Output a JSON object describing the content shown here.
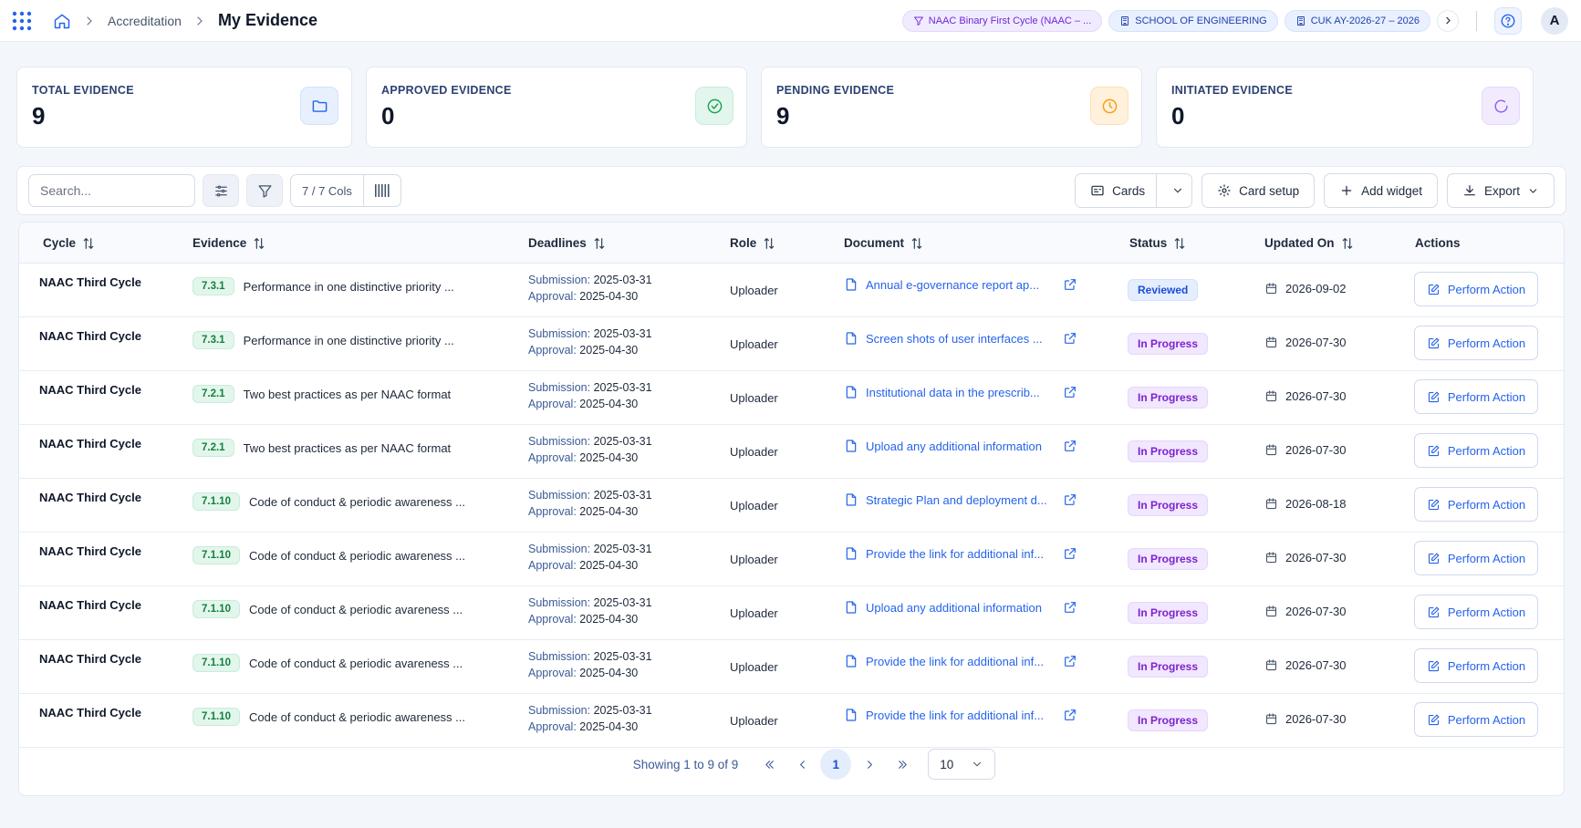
{
  "breadcrumb": {
    "parent": "Accreditation",
    "current": "My Evidence"
  },
  "context_chips": {
    "framework": "NAAC Binary First Cycle (NAAC – ...",
    "school": "SCHOOL OF ENGINEERING",
    "year": "CUK AY-2026-27 – 2026"
  },
  "user": {
    "avatar_initial": "A"
  },
  "stats": [
    {
      "label": "TOTAL EVIDENCE",
      "value": "9",
      "icon": "folder-icon",
      "accent": "#2563eb"
    },
    {
      "label": "APPROVED EVIDENCE",
      "value": "0",
      "icon": "check-circle-icon",
      "accent": "#16a34a"
    },
    {
      "label": "PENDING EVIDENCE",
      "value": "9",
      "icon": "clock-icon",
      "accent": "#f59e0b"
    },
    {
      "label": "INITIATED EVIDENCE",
      "value": "0",
      "icon": "spinner-icon",
      "accent": "#8b5cf6"
    }
  ],
  "toolbar": {
    "search_placeholder": "Search...",
    "cols_label": "7 / 7 Cols",
    "view_label": "Cards",
    "card_setup_label": "Card setup",
    "add_widget_label": "Add widget",
    "export_label": "Export"
  },
  "table": {
    "columns": [
      "Cycle",
      "Evidence",
      "Deadlines",
      "Role",
      "Document",
      "Status",
      "Updated On",
      "Actions"
    ],
    "deadline_labels": {
      "submission": "Submission:",
      "approval": "Approval:"
    },
    "rows": [
      {
        "cycle": "NAAC Third Cycle",
        "code": "7.3.1",
        "evidence": "Performance in one distinctive priority ...",
        "submission": "2025-03-31",
        "approval": "2025-04-30",
        "role": "Uploader",
        "document": "Annual e-governance report ap...",
        "status": "Reviewed",
        "updated": "2026-09-02",
        "action": "Perform Action"
      },
      {
        "cycle": "NAAC Third Cycle",
        "code": "7.3.1",
        "evidence": "Performance in one distinctive priority ...",
        "submission": "2025-03-31",
        "approval": "2025-04-30",
        "role": "Uploader",
        "document": "Screen shots of user interfaces ...",
        "status": "In Progress",
        "updated": "2026-07-30",
        "action": "Perform Action"
      },
      {
        "cycle": "NAAC Third Cycle",
        "code": "7.2.1",
        "evidence": "Two best practices as per NAAC format",
        "submission": "2025-03-31",
        "approval": "2025-04-30",
        "role": "Uploader",
        "document": "Institutional data in the prescrib...",
        "status": "In Progress",
        "updated": "2026-07-30",
        "action": "Perform Action"
      },
      {
        "cycle": "NAAC Third Cycle",
        "code": "7.2.1",
        "evidence": "Two best practices as per NAAC format",
        "submission": "2025-03-31",
        "approval": "2025-04-30",
        "role": "Uploader",
        "document": "Upload any additional information",
        "status": "In Progress",
        "updated": "2026-07-30",
        "action": "Perform Action"
      },
      {
        "cycle": "NAAC Third Cycle",
        "code": "7.1.10",
        "evidence": "Code of conduct & periodic awareness ...",
        "submission": "2025-03-31",
        "approval": "2025-04-30",
        "role": "Uploader",
        "document": "Strategic Plan and deployment d...",
        "status": "In Progress",
        "updated": "2026-08-18",
        "action": "Perform Action"
      },
      {
        "cycle": "NAAC Third Cycle",
        "code": "7.1.10",
        "evidence": "Code of conduct & periodic awareness ...",
        "submission": "2025-03-31",
        "approval": "2025-04-30",
        "role": "Uploader",
        "document": "Provide the link for additional inf...",
        "status": "In Progress",
        "updated": "2026-07-30",
        "action": "Perform Action"
      },
      {
        "cycle": "NAAC Third Cycle",
        "code": "7.1.10",
        "evidence": "Code of conduct & periodic avareness ...",
        "submission": "2025-03-31",
        "approval": "2025-04-30",
        "role": "Uploader",
        "document": "Upload any additional information",
        "status": "In Progress",
        "updated": "2026-07-30",
        "action": "Perform Action"
      },
      {
        "cycle": "NAAC Third Cycle",
        "code": "7.1.10",
        "evidence": "Code of conduct & periodic avareness ...",
        "submission": "2025-03-31",
        "approval": "2025-04-30",
        "role": "Uploader",
        "document": "Provide the link for additional inf...",
        "status": "In Progress",
        "updated": "2026-07-30",
        "action": "Perform Action"
      },
      {
        "cycle": "NAAC Third Cycle",
        "code": "7.1.10",
        "evidence": "Code of conduct & periodic awareness ...",
        "submission": "2025-03-31",
        "approval": "2025-04-30",
        "role": "Uploader",
        "document": "Provide the link for additional inf...",
        "status": "In Progress",
        "updated": "2026-07-30",
        "action": "Perform Action"
      }
    ]
  },
  "pagination": {
    "info": "Showing 1 to 9 of 9",
    "current_page": "1",
    "page_size": "10"
  }
}
